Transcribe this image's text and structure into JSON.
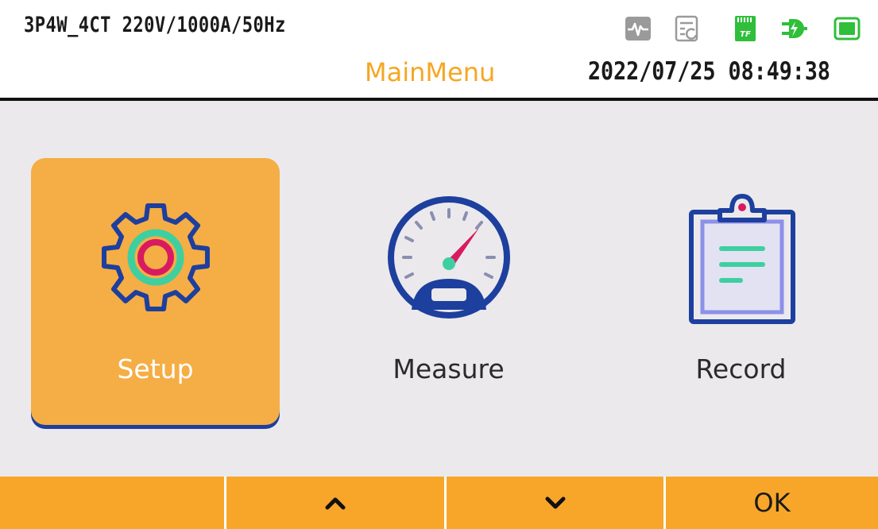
{
  "header": {
    "config": "3P4W_4CT 220V/1000A/50Hz",
    "title": "MainMenu",
    "datetime": "2022/07/25 08:49:38",
    "status_icons": [
      "waveform-icon",
      "report-icon",
      "sd-card-icon",
      "power-plug-icon",
      "battery-icon"
    ],
    "sd_label": "TF"
  },
  "menu": {
    "selected": "Setup",
    "items": [
      {
        "label": "Setup",
        "icon": "gear-icon"
      },
      {
        "label": "Measure",
        "icon": "gauge-icon"
      },
      {
        "label": "Record",
        "icon": "clipboard-icon"
      }
    ]
  },
  "footer": {
    "keys": [
      {
        "label": "",
        "icon": ""
      },
      {
        "label": "",
        "icon": "chevron-up-icon"
      },
      {
        "label": "",
        "icon": "chevron-down-icon"
      },
      {
        "label": "OK",
        "icon": ""
      }
    ]
  },
  "colors": {
    "accent": "#f6a623",
    "selected_tile": "#f5ad45",
    "icon_navy": "#1d3f9e",
    "icon_teal": "#3ecfa0",
    "icon_crimson": "#d81b60",
    "status_green": "#2fbf3a",
    "status_gray": "#9a9a9a"
  }
}
